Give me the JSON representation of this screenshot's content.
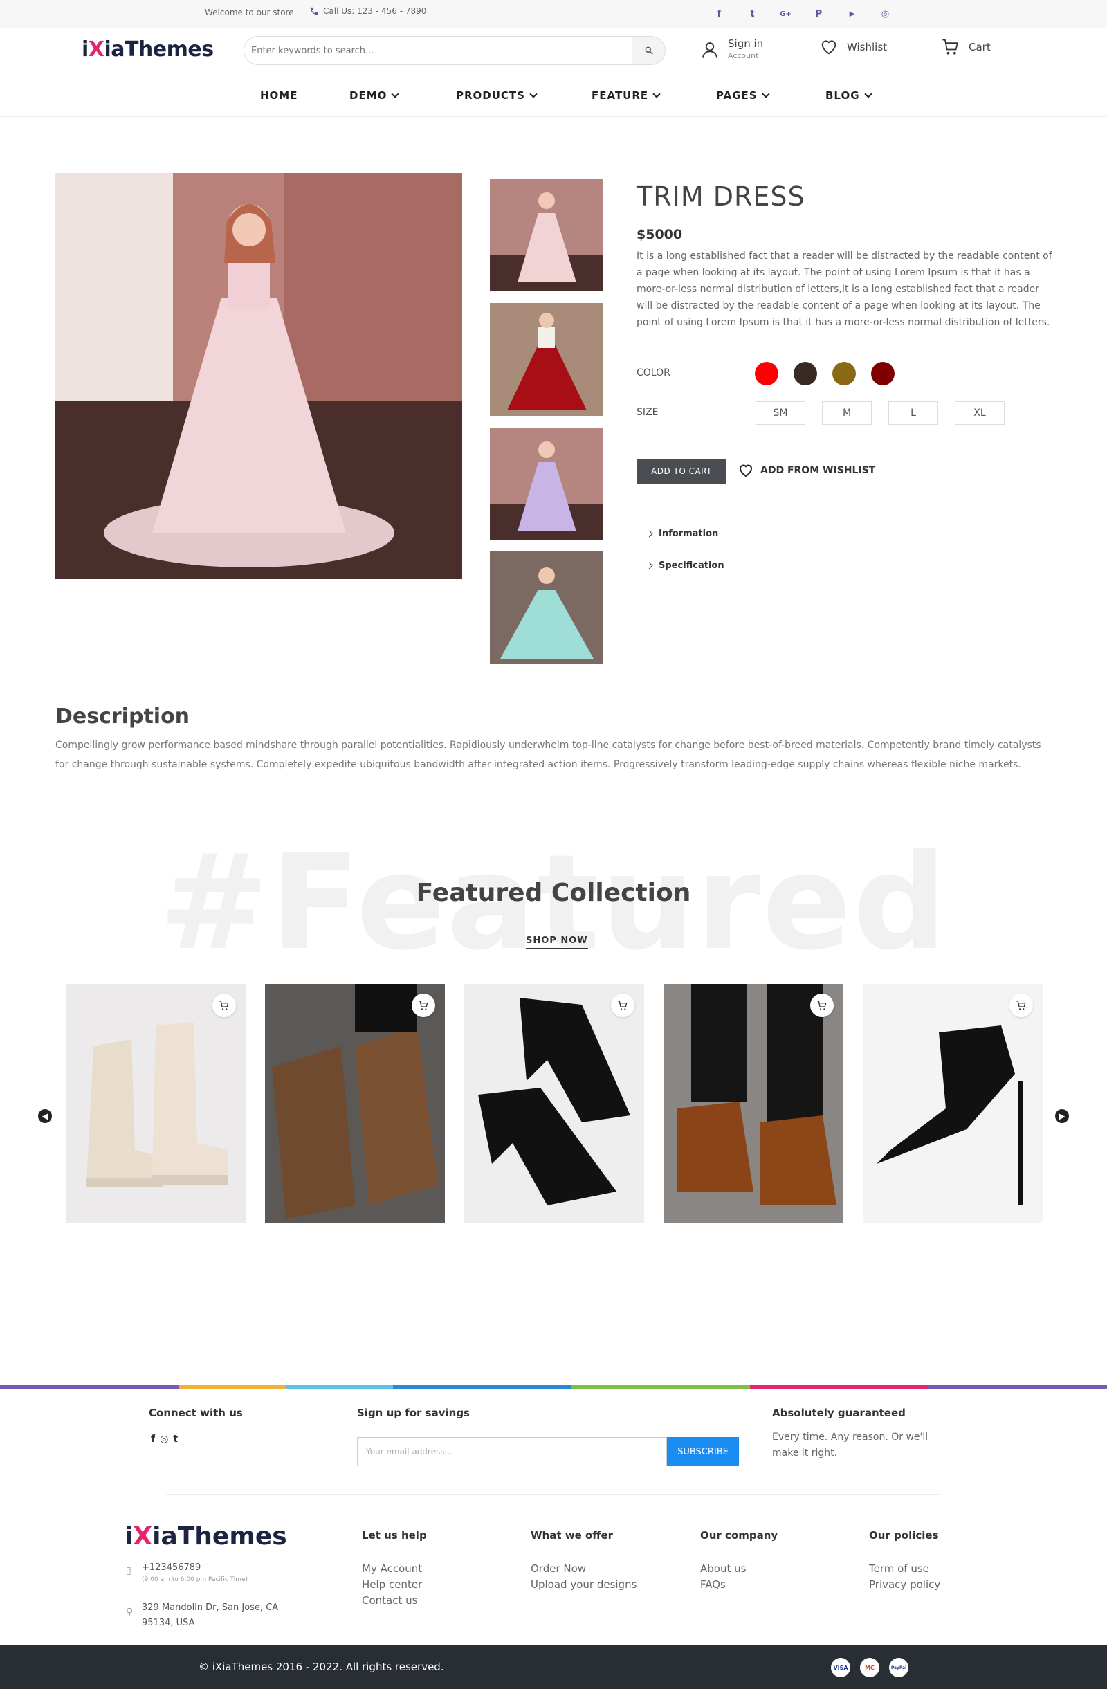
{
  "topbar": {
    "welcome": "Welcome to our store",
    "phone": "Call Us: 123 - 456 - 7890",
    "socials": [
      "f",
      "t",
      "G+",
      "P",
      "▶",
      "◎"
    ]
  },
  "header": {
    "logo_pre": "i",
    "logo_x": "X",
    "logo_post": "iaThemes",
    "search_placeholder": "Enter keywords to search...",
    "signin": "Sign in",
    "account": "Account",
    "wishlist": "Wishlist",
    "cart": "Cart"
  },
  "nav": [
    "HOME",
    "DEMO",
    "PRODUCTS",
    "FEATURE",
    "PAGES",
    "BLOG"
  ],
  "product": {
    "title": "TRIM DRESS",
    "price": "$5000",
    "description": "It is a long established fact that a reader will be distracted by the readable content of a page when looking at its layout. The point of using Lorem Ipsum is that it has a more-or-less normal distribution of letters,It is a long established fact that a reader will be distracted by the readable content of a page when looking at its layout. The point of using Lorem Ipsum is that it has a more-or-less normal distribution of letters.",
    "color_label": "COLOR",
    "colors": [
      "#ff0000",
      "#3a2a26",
      "#8b6914",
      "#7f0000"
    ],
    "size_label": "SIZE",
    "sizes": [
      "SM",
      "M",
      "L",
      "XL"
    ],
    "add_to_cart": "ADD TO CART",
    "add_wishlist": "ADD FROM WISHLIST",
    "accordion": [
      "Information",
      "Specification"
    ]
  },
  "description": {
    "heading": "Description",
    "text": "Compellingly grow performance based mindshare through parallel potentialities. Rapidiously underwhelm top-line catalysts for change before best-of-breed materials. Competently brand timely catalysts for change through sustainable systems. Completely expedite ubiquitous bandwidth after integrated action items. Progressively transform leading-edge supply chains whereas flexible niche markets."
  },
  "featured": {
    "bg_text": "#Featured",
    "heading": "Featured Collection",
    "shop_now": "SHOP NOW"
  },
  "footer": {
    "connect": "Connect with us",
    "signup": "Sign up for savings",
    "email_placeholder": "Your email address...",
    "subscribe": "SUBSCRIBE",
    "guaranteed": "Absolutely guaranteed",
    "guaranteed_text": "Every time. Any reason. Or we'll make it right.",
    "phone": "+123456789",
    "hours": "(9:00 am to 6:00 pm Pacific Time)",
    "address": "329 Mandolin Dr, San Jose, CA 95134, USA",
    "col1_head": "Let us help",
    "col1": [
      "My Account",
      "Help center",
      "Contact us"
    ],
    "col2_head": "What we offer",
    "col2": [
      "Order Now",
      "Upload your designs"
    ],
    "col3_head": "Our company",
    "col3": [
      "About us",
      "FAQs"
    ],
    "col4_head": "Our policies",
    "col4": [
      "Term of use",
      "Privacy policy"
    ],
    "copyright": "© iXiaThemes 2016 - 2022. All rights reserved.",
    "payments": [
      "VISA",
      "MC",
      "PayPal"
    ]
  }
}
